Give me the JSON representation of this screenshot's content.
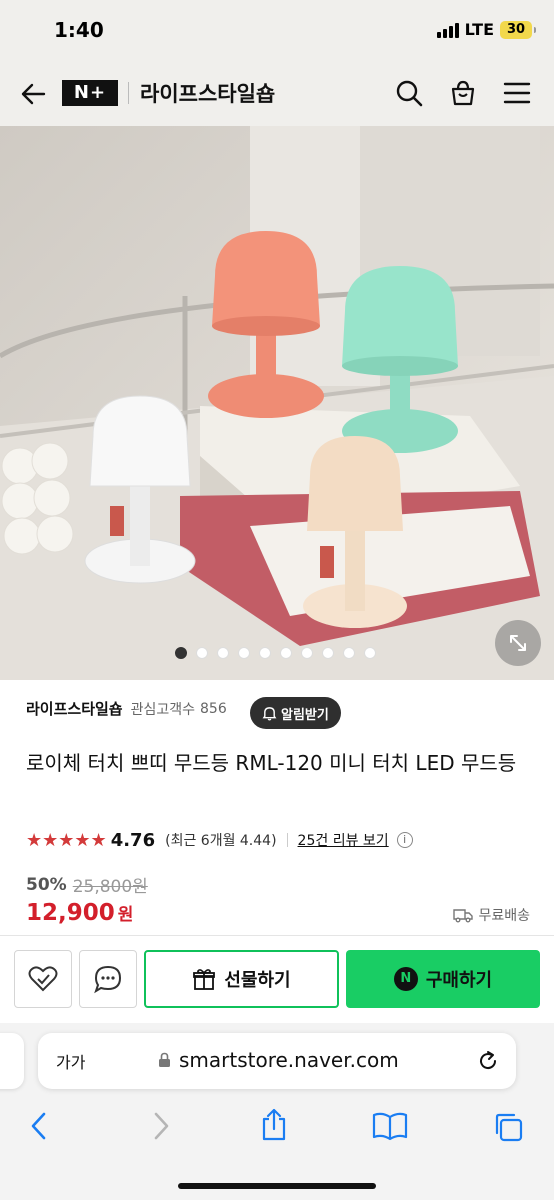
{
  "status": {
    "time": "1:40",
    "network": "LTE",
    "battery": "30"
  },
  "header": {
    "logo": "N+",
    "store_name": "라이프스타일숍"
  },
  "gallery": {
    "total_images": 10,
    "active_index": 0
  },
  "seller": {
    "name": "라이프스타일숍",
    "fans_label": "관심고객수",
    "fans_count": "856",
    "alarm_label": "알림받기"
  },
  "product": {
    "title": "로이체 터치 쁘띠 무드등 RML-120 미니 터치 LED 무드등",
    "stars": "★★★★★",
    "rating": "4.76",
    "recent_rating": "(최근 6개월 4.44)",
    "review_link": "25건 리뷰 보기",
    "discount": "50%",
    "original_price": "25,800원",
    "price": "12,900",
    "currency": "원",
    "shipping": "무료배송"
  },
  "actions": {
    "gift_label": "선물하기",
    "buy_label": "구매하기",
    "buy_badge": "N"
  },
  "browser": {
    "text_size_label": "가가",
    "url": "smartstore.naver.com"
  },
  "colors": {
    "accent_green": "#19cd64",
    "price_red": "#d31f2b",
    "star_red": "#d33a3a"
  }
}
